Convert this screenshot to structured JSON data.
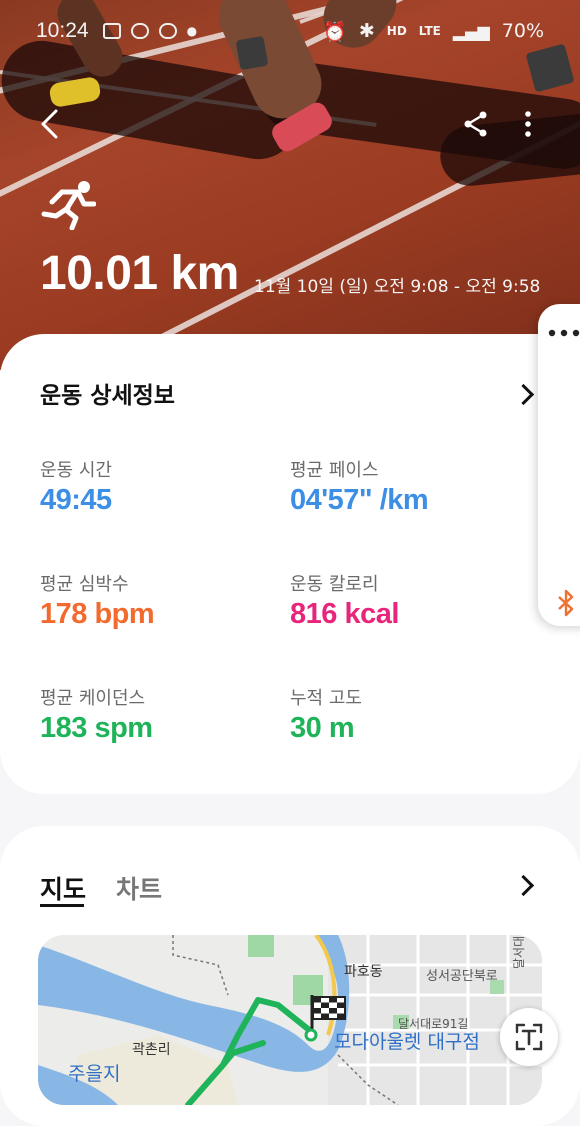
{
  "status_bar": {
    "time": "10:24",
    "battery": "70%",
    "network": "LTE",
    "hd_label": "HD"
  },
  "header": {
    "back_icon": "chevron-left-icon",
    "share_icon": "share-icon",
    "more_icon": "more-vertical-icon",
    "activity_icon": "running-icon",
    "distance": "10.01 km",
    "date_range": "11월 10일 (일) 오전 9:08 - 오전 9:58"
  },
  "details": {
    "title": "운동 상세정보",
    "stats": [
      {
        "label": "운동 시간",
        "value": "49:45",
        "color": "#3d8fe6"
      },
      {
        "label": "평균 페이스",
        "value": "04'57\" /km",
        "color": "#3d8fe6"
      },
      {
        "label": "평균 심박수",
        "value": "178 bpm",
        "color": "#f26a2e"
      },
      {
        "label": "운동 칼로리",
        "value": "816 kcal",
        "color": "#e8257a"
      },
      {
        "label": "평균 케이던스",
        "value": "183 spm",
        "color": "#1fb35a"
      },
      {
        "label": "누적 고도",
        "value": "30 m",
        "color": "#1fb35a"
      }
    ]
  },
  "side_panel": {
    "more_icon": "more-horizontal-icon",
    "bluetooth_icon": "bluetooth-icon"
  },
  "map_section": {
    "tabs": [
      "지도",
      "차트"
    ],
    "active_tab": "지도",
    "labels": {
      "paho": "파호동",
      "seongseo": "성서공단북로",
      "dalseo": "달서대로",
      "dalseo91": "달서대로91길",
      "gwakchon": "곽촌리",
      "juul": "주을지",
      "store": "모다아울렛 대구점"
    },
    "route_color": "#1fb35a"
  }
}
